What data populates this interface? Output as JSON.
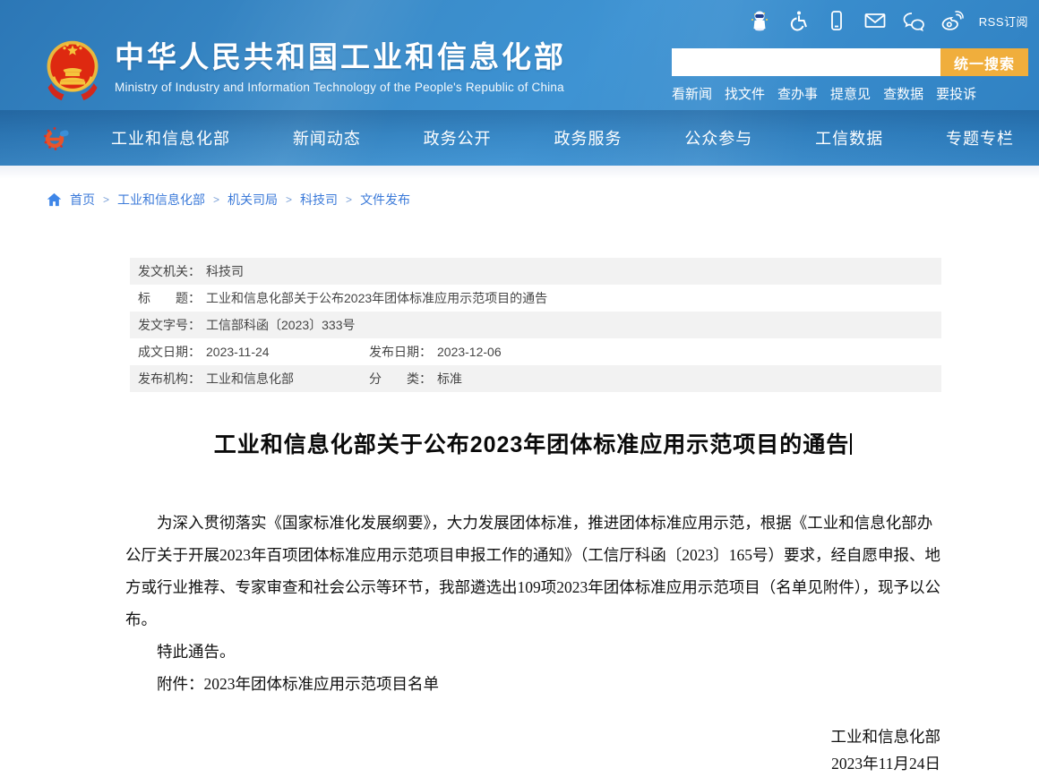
{
  "colors": {
    "header_blue": "#3a8cca",
    "nav_overlay": "#1d5d95",
    "search_button_orange": "#f0ae3c",
    "breadcrumb_blue": "#3b7ad9",
    "table_alt_row": "#f2f2f2",
    "emblem_red": "#de2910",
    "emblem_gold": "#f0c23c"
  },
  "topbar": {
    "icons": [
      "mascot-robot",
      "accessibility",
      "mobile",
      "mail",
      "wechat",
      "weibo"
    ],
    "rss_label": "RSS订阅"
  },
  "header": {
    "title_cn": "中华人民共和国工业和信息化部",
    "title_en": "Ministry of Industry and Information Technology of the People's Republic of China"
  },
  "search": {
    "input_value": "",
    "placeholder": "",
    "button_label": "统一搜索",
    "quick_links": [
      "看新闻",
      "找文件",
      "查办事",
      "提意见",
      "查数据",
      "要投诉"
    ]
  },
  "nav": {
    "items": [
      "工业和信息化部",
      "新闻动态",
      "政务公开",
      "政务服务",
      "公众参与",
      "工信数据",
      "专题专栏"
    ]
  },
  "breadcrumb": {
    "separator": ">",
    "items": [
      "首页",
      "工业和信息化部",
      "机关司局",
      "科技司",
      "文件发布"
    ]
  },
  "doc_meta": {
    "rows": [
      {
        "cells": [
          {
            "label": "发文机关：",
            "value": "科技司"
          }
        ]
      },
      {
        "cells": [
          {
            "label": "标　　题：",
            "value": "工业和信息化部关于公布2023年团体标准应用示范项目的通告"
          }
        ]
      },
      {
        "cells": [
          {
            "label": "发文字号：",
            "value": "工信部科函〔2023〕333号"
          }
        ]
      },
      {
        "cells": [
          {
            "label": "成文日期：",
            "value": "2023-11-24"
          },
          {
            "label": "发布日期：",
            "value": "2023-12-06"
          }
        ]
      },
      {
        "cells": [
          {
            "label": "发布机构：",
            "value": "工业和信息化部"
          },
          {
            "label": "分　　类：",
            "value": "标准"
          }
        ]
      }
    ]
  },
  "document": {
    "title": "工业和信息化部关于公布2023年团体标准应用示范项目的通告",
    "paragraphs": [
      "为深入贯彻落实《国家标准化发展纲要》，大力发展团体标准，推进团体标准应用示范，根据《工业和信息化部办公厅关于开展2023年百项团体标准应用示范项目申报工作的通知》（工信厅科函〔2023〕165号）要求，经自愿申报、地方或行业推荐、专家审查和社会公示等环节，我部遴选出109项2023年团体标准应用示范项目（名单见附件），现予以公布。",
      "特此通告。"
    ],
    "attachment": "附件：2023年团体标准应用示范项目名单",
    "signature": {
      "org": "工业和信息化部",
      "date": "2023年11月24日"
    }
  }
}
